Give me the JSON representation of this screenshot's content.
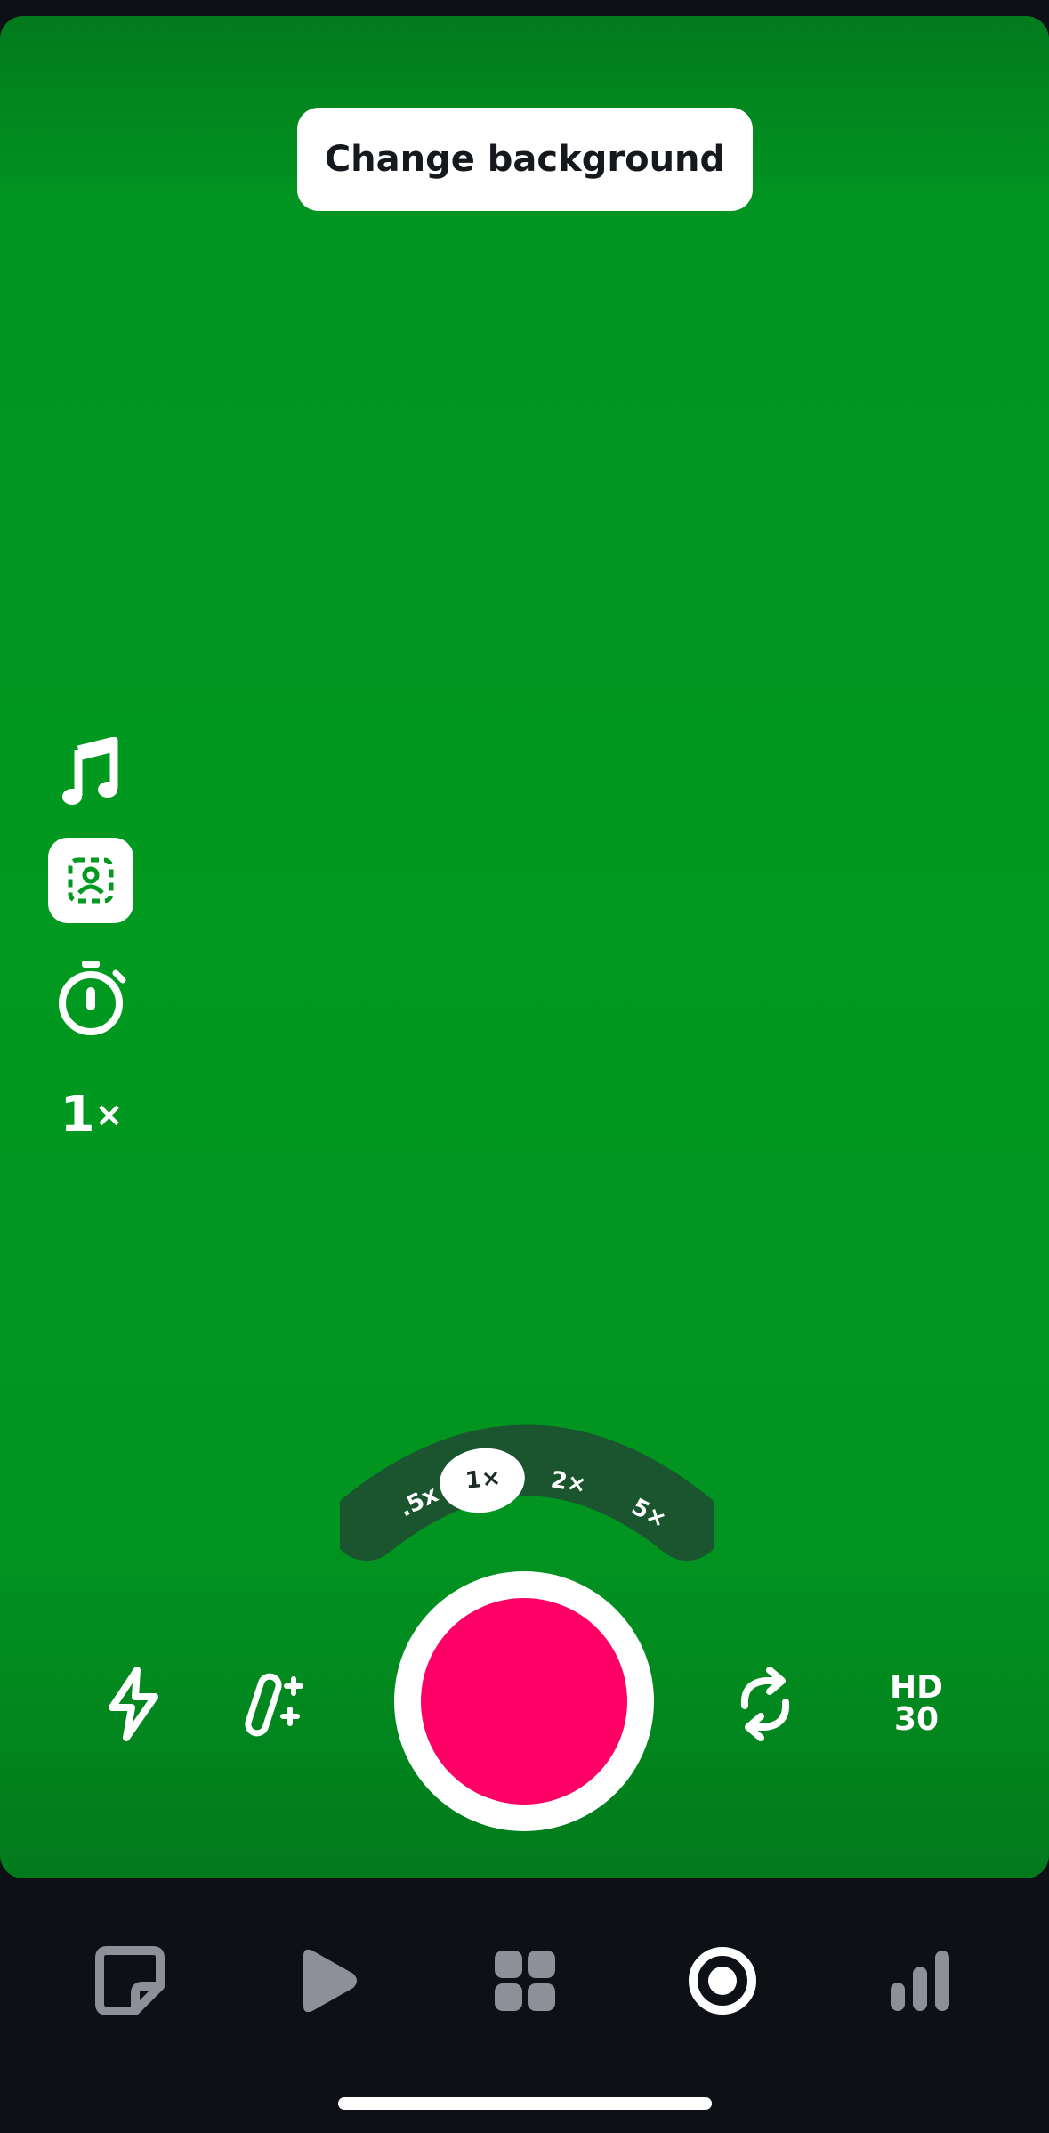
{
  "camera": {
    "change_background_label": "Change background",
    "side_tools": [
      {
        "icon": "music-note-icon"
      },
      {
        "icon": "person-frame-icon",
        "active": true
      },
      {
        "icon": "timer-icon"
      },
      {
        "icon": "speed-icon",
        "value": "1",
        "unit": "×"
      }
    ],
    "zoom_options": [
      {
        "label": ".5x",
        "selected": false
      },
      {
        "label": "1×",
        "selected": true
      },
      {
        "label": "2×",
        "selected": false
      },
      {
        "label": "5×",
        "selected": false
      }
    ],
    "bottom_tools": {
      "flash_icon": "flash-icon",
      "effects_icon": "magic-wand-icon",
      "flip_icon": "flip-camera-icon",
      "quality_line1": "HD",
      "quality_line2": "30"
    },
    "record_color": "#ff0066",
    "background_color": "#019920"
  },
  "tab_bar": {
    "tabs": [
      {
        "icon": "note-icon",
        "active": false
      },
      {
        "icon": "play-icon",
        "active": false
      },
      {
        "icon": "grid-icon",
        "active": false
      },
      {
        "icon": "record-tab-icon",
        "active": true
      },
      {
        "icon": "stats-icon",
        "active": false
      }
    ],
    "inactive_color": "#8e9099",
    "active_color": "#ffffff"
  }
}
